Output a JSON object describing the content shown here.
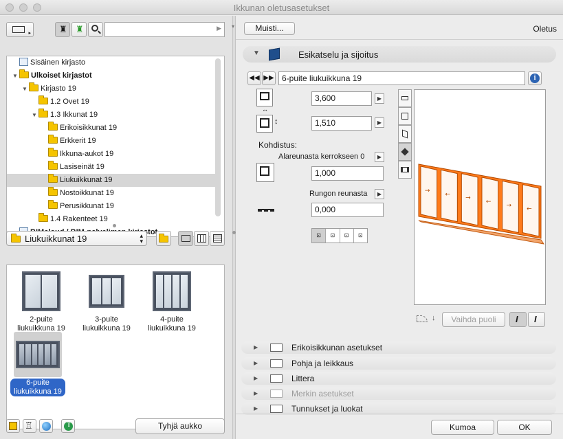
{
  "window": {
    "title": "Ikkunan oletusasetukset"
  },
  "left": {
    "search_placeholder": "",
    "tree": [
      {
        "label": "Sisäinen kirjasto",
        "level": 0,
        "icon": "library-icon",
        "expanded": false,
        "bold": false
      },
      {
        "label": "Ulkoiset kirjastot",
        "level": 0,
        "icon": "folder-icon",
        "expanded": true,
        "bold": true
      },
      {
        "label": "Kirjasto 19",
        "level": 1,
        "icon": "folder-icon",
        "expanded": true,
        "bold": false
      },
      {
        "label": "1.2 Ovet 19",
        "level": 2,
        "icon": "folder-icon",
        "expanded": false,
        "bold": false
      },
      {
        "label": "1.3 Ikkunat 19",
        "level": 2,
        "icon": "folder-icon",
        "expanded": true,
        "bold": false
      },
      {
        "label": "Erikoisikkunat 19",
        "level": 3,
        "icon": "folder-icon",
        "expanded": false,
        "bold": false
      },
      {
        "label": "Erkkerit 19",
        "level": 3,
        "icon": "folder-icon",
        "expanded": false,
        "bold": false
      },
      {
        "label": "Ikkuna-aukot 19",
        "level": 3,
        "icon": "folder-icon",
        "expanded": false,
        "bold": false
      },
      {
        "label": "Lasiseinät 19",
        "level": 3,
        "icon": "folder-icon",
        "expanded": false,
        "bold": false
      },
      {
        "label": "Liukuikkunat 19",
        "level": 3,
        "icon": "folder-icon",
        "expanded": false,
        "bold": false,
        "selected": true
      },
      {
        "label": "Nostoikkunat 19",
        "level": 3,
        "icon": "folder-icon",
        "expanded": false,
        "bold": false
      },
      {
        "label": "Perusikkunat 19",
        "level": 3,
        "icon": "folder-icon",
        "expanded": false,
        "bold": false
      },
      {
        "label": "1.4 Rakenteet 19",
        "level": 2,
        "icon": "folder-icon",
        "expanded": false,
        "bold": false
      },
      {
        "label": "BIMcloud / BIM-palvelimen kirjastot",
        "level": 0,
        "icon": "cloud-library-icon",
        "expanded": false,
        "bold": true
      }
    ],
    "folder_select": "Liukuikkunat 19",
    "gallery": [
      {
        "line1": "2-puite",
        "line2": "liukuikkuna 19",
        "panes": 2,
        "selected": false
      },
      {
        "line1": "3-puite",
        "line2": "liukuikkuna 19",
        "panes": 3,
        "selected": false
      },
      {
        "line1": "4-puite",
        "line2": "liukuikkuna 19",
        "panes": 4,
        "selected": false
      },
      {
        "line1": "6-puite",
        "line2": "liukuikkuna 19",
        "panes": 6,
        "selected": true
      }
    ],
    "empty_opening_button": "Tyhjä aukko"
  },
  "right": {
    "memo_button": "Muisti...",
    "default_label": "Oletus",
    "preview_section": "Esikatselu ja sijoitus",
    "object_name": "6-puite liukuikkuna 19",
    "width_value": "3,600",
    "height_value": "1,510",
    "anchor_label": "Kohdistus:",
    "anchor_option": "Alareunasta kerrokseen 0",
    "anchor_value": "1,000",
    "frame_option": "Rungon reunasta",
    "frame_value": "0,000",
    "flip_button": "Vaihda puoli",
    "panels": [
      {
        "label": "Erikoisikkunan asetukset",
        "disabled": false
      },
      {
        "label": "Pohja ja leikkaus",
        "disabled": false
      },
      {
        "label": "Littera",
        "disabled": false
      },
      {
        "label": "Merkin asetukset",
        "disabled": true
      },
      {
        "label": "Tunnukset ja luokat",
        "disabled": false
      }
    ],
    "cancel_button": "Kumoa",
    "ok_button": "OK"
  },
  "colors": {
    "window_accent": "#ff7a1a",
    "selection_blue": "#2f66c7"
  }
}
